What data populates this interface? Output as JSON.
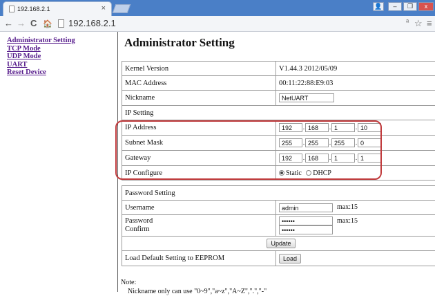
{
  "browser": {
    "tab_title": "192.168.2.1",
    "tab_close": "×",
    "url": "192.168.2.1",
    "nav": {
      "back": "←",
      "forward": "→",
      "reload": "C",
      "home": "🏠"
    },
    "toolbar_icons": {
      "extension": "ᵃ",
      "star": "☆",
      "menu": "≡"
    },
    "window_buttons": {
      "user": "👤",
      "minimize": "–",
      "restore": "❐",
      "close": "x"
    }
  },
  "sidebar": {
    "items": [
      {
        "label": "Administrator Setting"
      },
      {
        "label": "TCP Mode"
      },
      {
        "label": "UDP Mode"
      },
      {
        "label": "UART"
      },
      {
        "label": "Reset Device"
      }
    ]
  },
  "page": {
    "title": "Administrator Setting",
    "kernel": {
      "label": "Kernel Version",
      "value": "V1.44.3 2012/05/09"
    },
    "mac": {
      "label": "MAC Address",
      "value": "00:11:22:88:E9:03"
    },
    "nickname": {
      "label": "Nickname",
      "value": "NetUART"
    },
    "ip_section": {
      "label": "IP Setting"
    },
    "ip_address": {
      "label": "IP Address",
      "octets": [
        "192",
        "168",
        "1",
        "10"
      ]
    },
    "subnet": {
      "label": "Subnet Mask",
      "octets": [
        "255",
        "255",
        "255",
        "0"
      ]
    },
    "gateway": {
      "label": "Gateway",
      "octets": [
        "192",
        "168",
        "1",
        "1"
      ]
    },
    "ip_configure": {
      "label": "IP Configure",
      "options": [
        "Static",
        "DHCP"
      ],
      "selected": "Static"
    },
    "password_section": {
      "label": "Password Setting"
    },
    "username": {
      "label": "Username",
      "value": "admin",
      "max": "max:15"
    },
    "password": {
      "label": "Password",
      "confirm_label": "Confirm",
      "value": "••••••",
      "confirm_value": "••••••",
      "max": "max:15"
    },
    "update_button": "Update",
    "load_default": {
      "label": "Load Default Setting to EEPROM",
      "button": "Load"
    },
    "note": {
      "title": "Note:",
      "line": "Nickname only can use \"0~9\",\"a~z\",\"A~Z\",\".\",\"-\""
    }
  },
  "colors": {
    "highlight": "#c0393b",
    "link": "#551a8b",
    "chrome": "#4a7fc7"
  }
}
